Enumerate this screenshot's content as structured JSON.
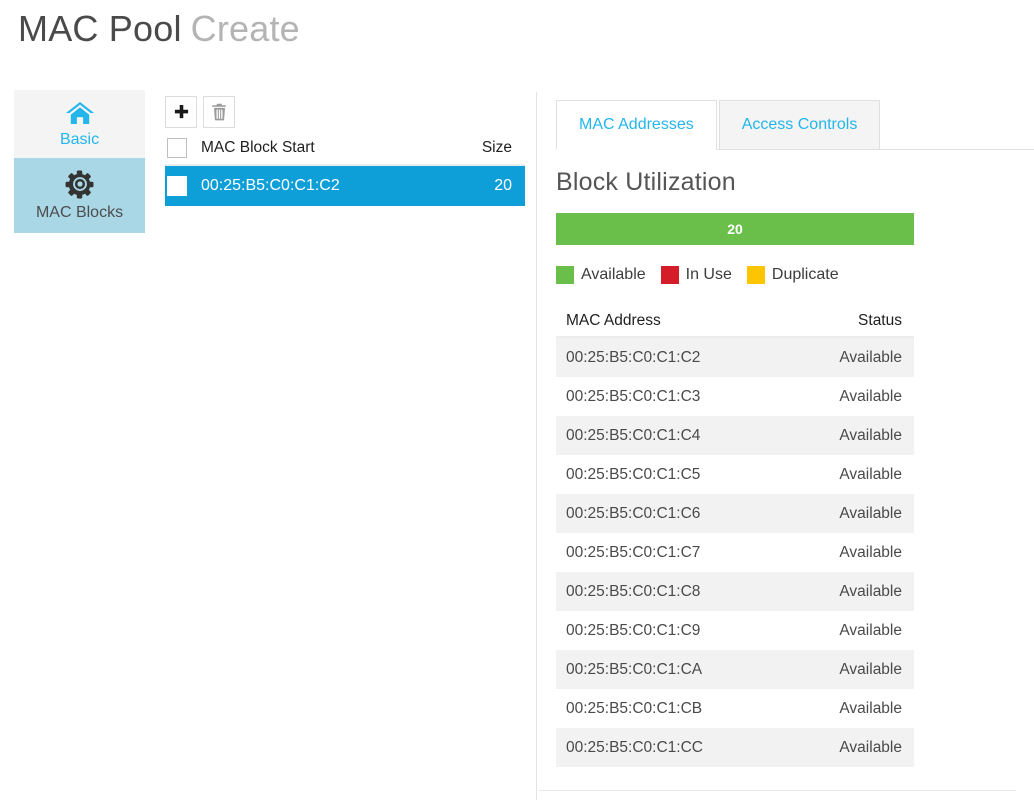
{
  "header": {
    "title_main": "MAC Pool",
    "title_sub": "Create"
  },
  "sidebar": {
    "items": [
      {
        "label": "Basic",
        "icon": "home-icon",
        "selected": false
      },
      {
        "label": "MAC Blocks",
        "icon": "gear-icon",
        "selected": true
      }
    ]
  },
  "blocks_panel": {
    "toolbar": {
      "add_label": "+",
      "add_icon": "plus-icon",
      "delete_icon": "trash-icon"
    },
    "columns": [
      "MAC Block Start",
      "Size"
    ],
    "rows": [
      {
        "mac_block_start": "00:25:B5:C0:C1:C2",
        "size": "20",
        "selected": true,
        "checked": false
      }
    ]
  },
  "right_panel": {
    "tabs": [
      {
        "label": "MAC Addresses",
        "active": true
      },
      {
        "label": "Access Controls",
        "active": false
      }
    ],
    "section_title": "Block Utilization",
    "utilization": {
      "segments": [
        {
          "status": "Available",
          "value": "20",
          "percent": 100,
          "color": "#6abf4b"
        }
      ]
    },
    "legend": [
      {
        "label": "Available",
        "color": "#6abf4b"
      },
      {
        "label": "In Use",
        "color": "#d51c29"
      },
      {
        "label": "Duplicate",
        "color": "#fdc500"
      }
    ],
    "mac_table": {
      "columns": [
        "MAC Address",
        "Status"
      ],
      "rows": [
        {
          "address": "00:25:B5:C0:C1:C2",
          "status": "Available"
        },
        {
          "address": "00:25:B5:C0:C1:C3",
          "status": "Available"
        },
        {
          "address": "00:25:B5:C0:C1:C4",
          "status": "Available"
        },
        {
          "address": "00:25:B5:C0:C1:C5",
          "status": "Available"
        },
        {
          "address": "00:25:B5:C0:C1:C6",
          "status": "Available"
        },
        {
          "address": "00:25:B5:C0:C1:C7",
          "status": "Available"
        },
        {
          "address": "00:25:B5:C0:C1:C8",
          "status": "Available"
        },
        {
          "address": "00:25:B5:C0:C1:C9",
          "status": "Available"
        },
        {
          "address": "00:25:B5:C0:C1:CA",
          "status": "Available"
        },
        {
          "address": "00:25:B5:C0:C1:CB",
          "status": "Available"
        },
        {
          "address": "00:25:B5:C0:C1:CC",
          "status": "Available"
        }
      ]
    }
  },
  "colors": {
    "accent_blue": "#0f9fd8",
    "link_blue": "#23b6ea",
    "selected_nav": "#a9d7e6",
    "available_green": "#6abf4b",
    "in_use_red": "#d51c29",
    "duplicate_yellow": "#fdc500"
  }
}
